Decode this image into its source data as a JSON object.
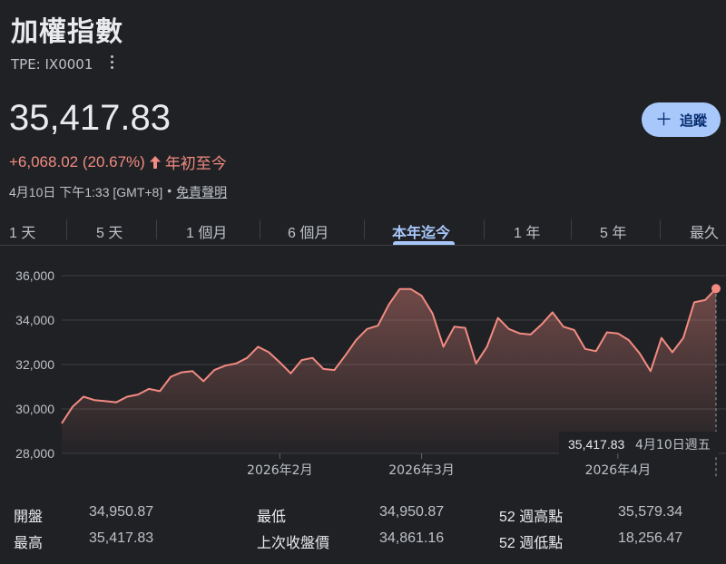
{
  "header": {
    "title": "加權指數",
    "ticker": "TPE: IX0001",
    "price": "35,417.83",
    "change": "+6,068.02 (20.67%)",
    "change_arrow": "arrow-up-icon",
    "change_period": "年初至今",
    "timestamp": "4月10日 下午1:33 [GMT+8]",
    "separator": "•",
    "disclaimer": "免責聲明",
    "follow_label": "追蹤"
  },
  "tabs": [
    {
      "label": "1 天",
      "active": false
    },
    {
      "label": "5 天",
      "active": false
    },
    {
      "label": "1 個月",
      "active": false
    },
    {
      "label": "6 個月",
      "active": false
    },
    {
      "label": "本年迄今",
      "active": true
    },
    {
      "label": "1 年",
      "active": false
    },
    {
      "label": "5 年",
      "active": false
    },
    {
      "label": "最久",
      "active": false
    }
  ],
  "colors": {
    "background": "#202124",
    "line": "#f28b82",
    "accent": "#a8c7fa"
  },
  "chart_data": {
    "type": "area",
    "y_ticks": [
      "36,000",
      "34,000",
      "32,000",
      "30,000",
      "28,000"
    ],
    "ylim": [
      28000,
      36000
    ],
    "x_labels": [
      {
        "label": "2026年2月",
        "index": 20
      },
      {
        "label": "2026年3月",
        "index": 33
      },
      {
        "label": "2026年4月",
        "index": 51
      }
    ],
    "grid": true,
    "values": [
      29350,
      30100,
      30550,
      30400,
      30350,
      30300,
      30550,
      30650,
      30900,
      30800,
      31450,
      31650,
      31700,
      31250,
      31750,
      31950,
      32050,
      32300,
      32800,
      32550,
      32100,
      31600,
      32200,
      32300,
      31800,
      31750,
      32400,
      33100,
      33600,
      33750,
      34700,
      35400,
      35400,
      35100,
      34300,
      32800,
      33700,
      33650,
      32050,
      32800,
      34100,
      33600,
      33400,
      33350,
      33800,
      34350,
      33700,
      33550,
      32700,
      32600,
      33450,
      33400,
      33100,
      32500,
      31700,
      33200,
      32550,
      33200,
      34800,
      34900,
      35417.83
    ],
    "tooltip": {
      "value": "35,417.83",
      "date": "4月10日週五"
    }
  },
  "stats": [
    {
      "label": "開盤",
      "value": "34,950.87"
    },
    {
      "label": "最高",
      "value": "35,417.83"
    },
    {
      "label": "最低",
      "value": "34,950.87"
    },
    {
      "label": "上次收盤價",
      "value": "34,861.16"
    },
    {
      "label": "52 週高點",
      "value": "35,579.34"
    },
    {
      "label": "52 週低點",
      "value": "18,256.47"
    }
  ]
}
